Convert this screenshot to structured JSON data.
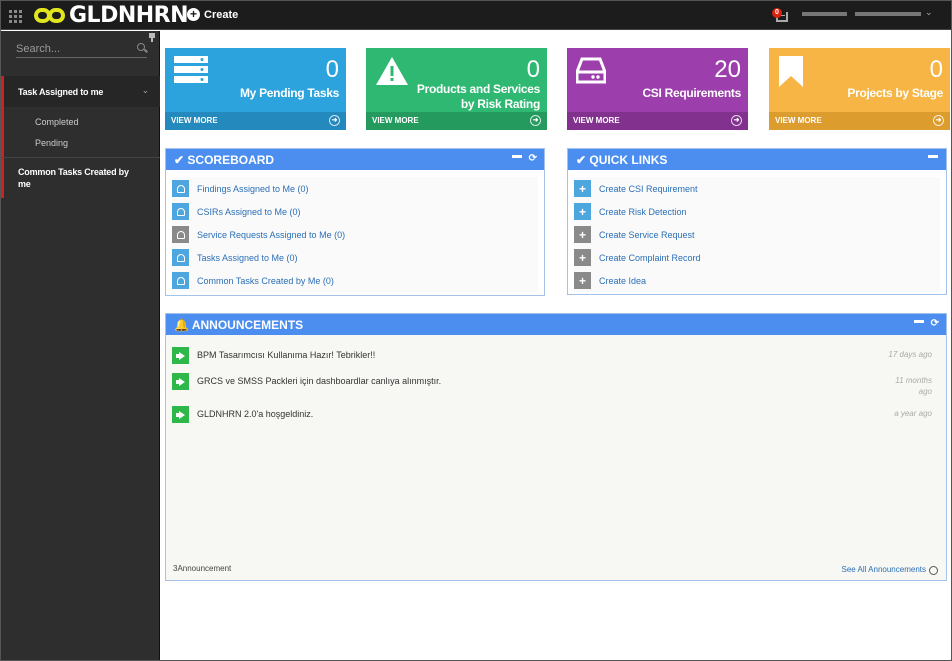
{
  "topbar": {
    "logo_text": "GLDNHRN",
    "create_label": "Create",
    "notification_count": "0"
  },
  "sidebar": {
    "search_placeholder": "Search...",
    "items": [
      {
        "label": "Task Assigned to me",
        "children": [
          "Completed",
          "Pending"
        ]
      },
      {
        "label": "Common Tasks Created by me"
      }
    ]
  },
  "tiles": [
    {
      "value": "0",
      "label": "My Pending Tasks",
      "footer": "VIEW MORE",
      "color": "#2da3dd",
      "icon": "server-icon"
    },
    {
      "value": "0",
      "label": "Products and Services by Risk Rating",
      "footer": "VIEW MORE",
      "color": "#2eb872",
      "icon": "warning-icon"
    },
    {
      "value": "20",
      "label": "CSI Requirements",
      "footer": "VIEW MORE",
      "color": "#9c3eac",
      "icon": "hard-drive-icon"
    },
    {
      "value": "0",
      "label": "Projects by Stage",
      "footer": "VIEW MORE",
      "color": "#f7b545",
      "icon": "bookmark-icon"
    }
  ],
  "scoreboard": {
    "title": "SCOREBOARD",
    "items": [
      {
        "label": "Findings Assigned to Me (0)",
        "icon": "bell-icon",
        "color": "#4da6dd"
      },
      {
        "label": "CSIRs Assigned to Me (0)",
        "icon": "bell-icon",
        "color": "#4da6dd"
      },
      {
        "label": "Service Requests Assigned to Me (0)",
        "icon": "bell-icon",
        "color": "#8a8a8a"
      },
      {
        "label": "Tasks Assigned to Me (0)",
        "icon": "bell-icon",
        "color": "#4da6dd"
      },
      {
        "label": "Common Tasks Created by Me (0)",
        "icon": "bell-icon",
        "color": "#4da6dd"
      }
    ]
  },
  "quicklinks": {
    "title": "QUICK LINKS",
    "items": [
      {
        "label": "Create CSI Requirement",
        "icon": "plus-icon",
        "color": "#4da6dd"
      },
      {
        "label": "Create Risk Detection",
        "icon": "plus-icon",
        "color": "#4da6dd"
      },
      {
        "label": "Create Service Request",
        "icon": "plus-icon",
        "color": "#8a8a8a"
      },
      {
        "label": "Create Complaint Record",
        "icon": "plus-icon",
        "color": "#8a8a8a"
      },
      {
        "label": "Create Idea",
        "icon": "plus-icon",
        "color": "#8a8a8a"
      }
    ]
  },
  "announcements": {
    "title": "ANNOUNCEMENTS",
    "items": [
      {
        "text": "BPM Tasarımcısı Kullanıma Hazır! Tebrikler!!",
        "ago": "17 days ago"
      },
      {
        "text": "GRCS ve SMSS Packleri için dashboardlar canlıya alınmıştır.",
        "ago": "11 months ago"
      },
      {
        "text": "GLDNHRN 2.0'a hoşgeldiniz.",
        "ago": "a year ago"
      }
    ],
    "count_label": "3Announcement",
    "see_all_label": "See All Announcements"
  }
}
